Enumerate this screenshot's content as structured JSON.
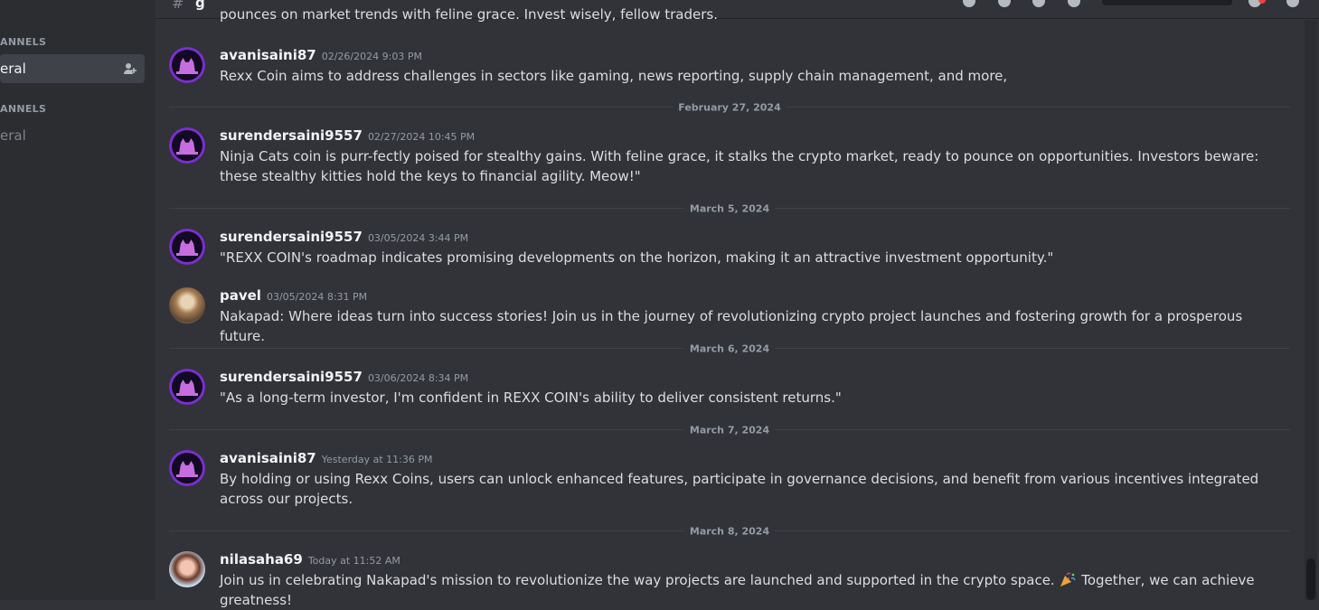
{
  "sidebar": {
    "categories": [
      {
        "label": "ANNELS"
      },
      {
        "label": "ANNELS"
      }
    ],
    "channels": [
      {
        "label": "eral",
        "selected": true,
        "icon": "add-user-icon"
      },
      {
        "label": "eral",
        "selected": false
      }
    ]
  },
  "topbar": {
    "channel_partial": "g",
    "icons": [
      "threads-icon",
      "mute-icon",
      "pin-icon",
      "members-icon",
      "search-box",
      "inbox-icon",
      "help-icon"
    ]
  },
  "partial_top_message": "pounces on market trends with feline grace. Invest wisely, fellow traders.",
  "messages": [
    {
      "author": "avanisaini87",
      "timestamp": "02/26/2024 9:03 PM",
      "avatar": "cat-avatar",
      "text": "Rexx Coin aims to address challenges in sectors like gaming, news reporting, supply chain management, and more,"
    },
    {
      "divider": "February 27, 2024"
    },
    {
      "author": "surendersaini9557",
      "timestamp": "02/27/2024 10:45 PM",
      "avatar": "cat-avatar",
      "text": "Ninja Cats coin is purr-fectly poised for stealthy gains. With feline grace, it stalks the crypto market, ready to pounce on opportunities. Investors beware: these stealthy kitties hold the keys to financial agility. Meow!\""
    },
    {
      "divider": "March 5, 2024"
    },
    {
      "author": "surendersaini9557",
      "timestamp": "03/05/2024 3:44 PM",
      "avatar": "cat-avatar",
      "text": "\"REXX COIN's roadmap indicates promising developments on the horizon, making it an attractive investment opportunity.\""
    },
    {
      "author": "pavel",
      "timestamp": "03/05/2024 8:31 PM",
      "avatar": "pavel-avatar",
      "text": "Nakapad: Where ideas turn into success stories! Join us in the journey of revolutionizing crypto project launches and fostering growth for a prosperous future."
    },
    {
      "divider": "March 6, 2024"
    },
    {
      "author": "surendersaini9557",
      "timestamp": "03/06/2024 8:34 PM",
      "avatar": "cat-avatar",
      "text": "\"As a long-term investor, I'm confident in REXX COIN's ability to deliver consistent returns.\""
    },
    {
      "divider": "March 7, 2024"
    },
    {
      "author": "avanisaini87",
      "timestamp": "Yesterday at 11:36 PM",
      "avatar": "cat-avatar",
      "text": "By holding or using Rexx Coins, users can unlock enhanced features, participate in governance decisions, and benefit from various incentives integrated across our projects."
    },
    {
      "divider": "March 8, 2024"
    },
    {
      "author": "nilasaha69",
      "timestamp": "Today at 11:52 AM",
      "avatar": "nila-avatar",
      "text_before": "Join us in celebrating Nakapad's mission to revolutionize the way projects are launched and supported in the crypto space.",
      "emoji": "party-popper-icon",
      "text_after": "Together, we can achieve greatness!"
    }
  ]
}
